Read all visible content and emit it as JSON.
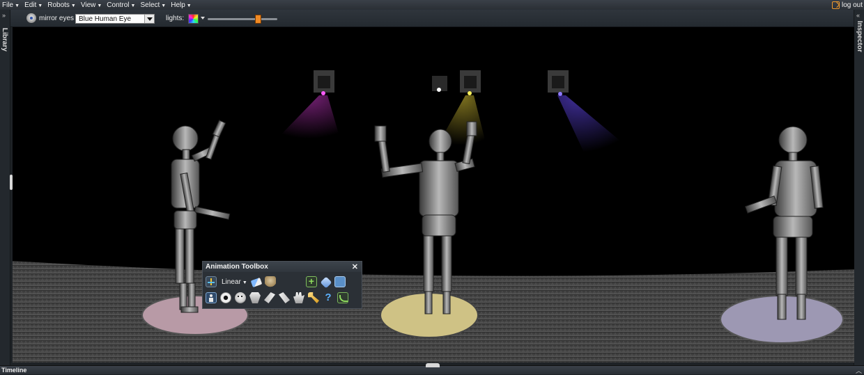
{
  "menubar": {
    "items": [
      "File",
      "Edit",
      "Robots",
      "View",
      "Control",
      "Select",
      "Help"
    ],
    "logout_label": "log out"
  },
  "toolbar": {
    "mirror_eyes_label": "mirror eyes",
    "eye_selected": "Blue Human Eye",
    "lights_label": "lights:",
    "light_slider_level": 0.72
  },
  "side_tabs": {
    "left": "Library",
    "right": "Inspector"
  },
  "animation_toolbox": {
    "title": "Animation Toolbox",
    "interpolation": "Linear",
    "row1_icons": [
      "fk-joint-icon",
      "eraser-icon",
      "skull-icon",
      "add-keyframe-icon",
      "tag-icon",
      "screen-icon"
    ],
    "row2_icons": [
      "body-icon",
      "eye-icon",
      "face-icon",
      "torso-icon",
      "arm-icon",
      "forearm-icon",
      "hand-icon",
      "key-icon",
      "help-icon",
      "curve-icon"
    ]
  },
  "timeline": {
    "label": "Timeline"
  },
  "colors": {
    "accent": "#f08a24",
    "light_magenta": "#d43bd4",
    "light_yellow": "#e8d23a",
    "light_blue": "#6a4dff",
    "pad_pink": "#b89aa6",
    "pad_yellow": "#cfc285",
    "pad_lavender": "#9d98b3"
  }
}
